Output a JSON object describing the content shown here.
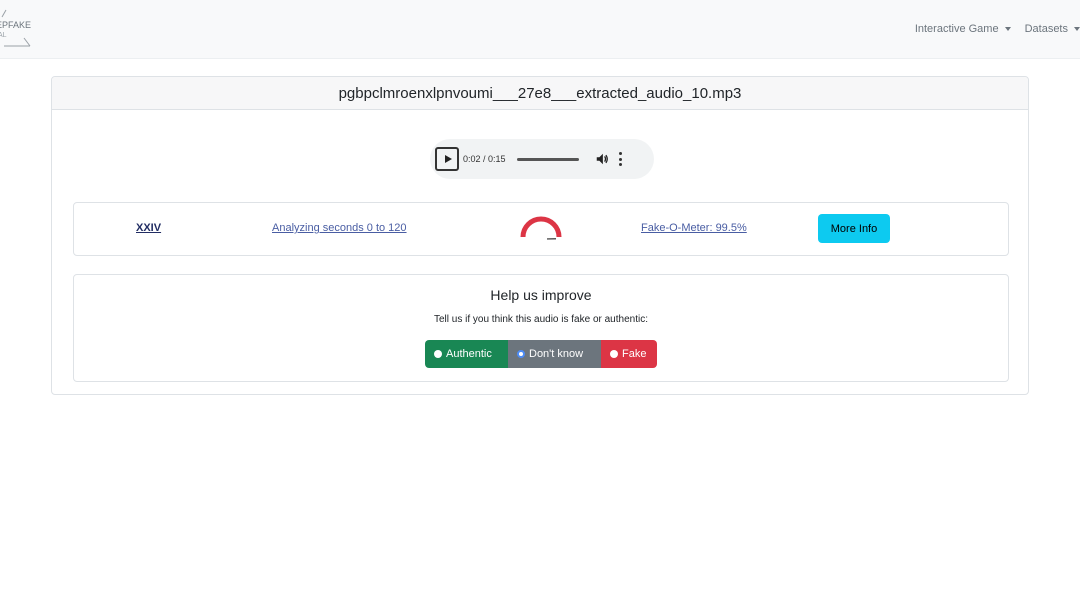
{
  "navbar": {
    "logo_text": "EPFAKE",
    "logo_sub": "AL",
    "links": [
      {
        "label": "Interactive Game"
      },
      {
        "label": "Datasets"
      }
    ]
  },
  "card": {
    "title": "pgbpclmroenxlpnvoumi___27e8___extracted_audio_10.mp3"
  },
  "audio": {
    "time": "0:02 / 0:15",
    "progress_fraction": 0.13
  },
  "result": {
    "segment": "XXIV",
    "range_text": "Analyzing seconds 0 to 120",
    "meter_text": "Fake-O-Meter: 99.5%",
    "meter_value": 99.5,
    "more_info_label": "More Info",
    "colors": {
      "gauge": "#dc3545",
      "link": "#495da3",
      "button": "#0dcaf0"
    }
  },
  "feedback": {
    "title": "Help us improve",
    "subtitle": "Tell us if you think this audio is fake or authentic:",
    "options": [
      {
        "label": "Authentic",
        "color": "#198754"
      },
      {
        "label": "Don't know",
        "color": "#6c757d"
      },
      {
        "label": "Fake",
        "color": "#dc3545"
      }
    ]
  }
}
